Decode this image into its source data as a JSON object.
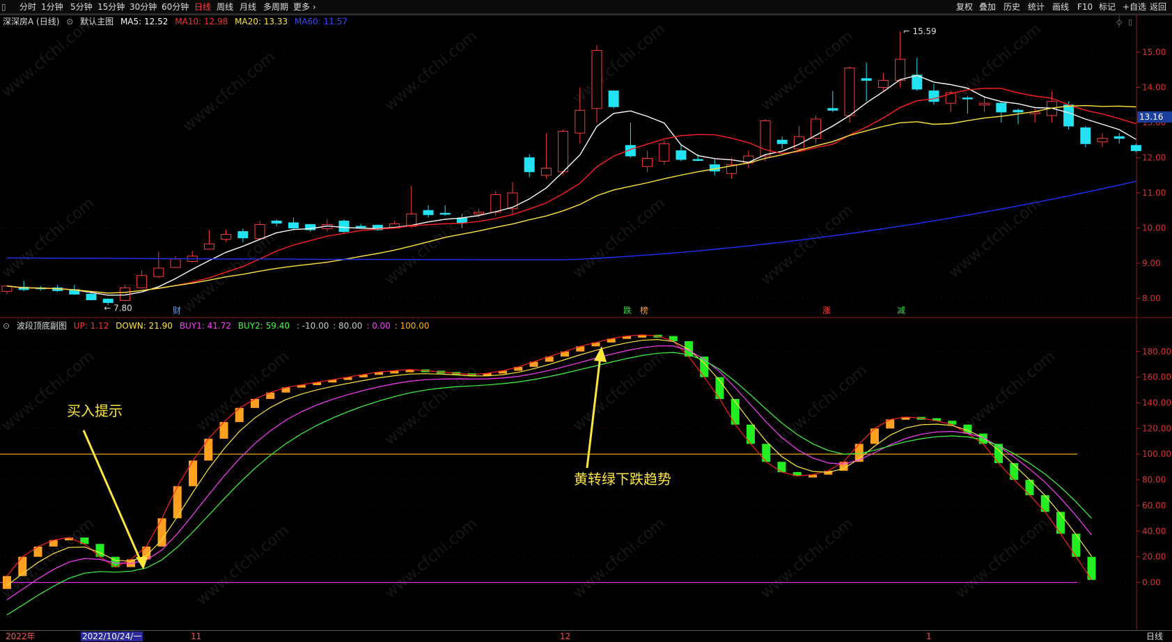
{
  "toolbar": {
    "menu_icon": "grid-menu-icon",
    "periods": [
      "分时",
      "1分钟",
      "5分钟",
      "15分钟",
      "30分钟",
      "60分钟",
      "日线",
      "周线",
      "月线",
      "多周期",
      "更多 ›"
    ],
    "active_period": "日线",
    "right_buttons": [
      "复权",
      "叠加",
      "历史",
      "统计",
      "画线",
      "F10",
      "标记",
      "+自选",
      "返回"
    ]
  },
  "main_panel": {
    "stock": "深深房A (日线)",
    "indicator": "默认主图",
    "ma": [
      {
        "label": "MA5: 12.52",
        "color": "#ffffff"
      },
      {
        "label": "MA10: 12.98",
        "color": "#ff2a2a"
      },
      {
        "label": "MA20: 13.33",
        "color": "#ffe63c"
      },
      {
        "label": "MA60: 11.57",
        "color": "#2e3cff"
      }
    ],
    "y_ticks": [
      "15.00",
      "14.00",
      "13.00",
      "12.00",
      "11.00",
      "10.00",
      "9.00",
      "8.00"
    ],
    "current_price": "13.16",
    "high_label": "15.59",
    "low_label": "7.80",
    "event_marks": [
      {
        "text": "财",
        "color": "#5aa0ff"
      },
      {
        "text": "跌",
        "color": "#2edb4c"
      },
      {
        "text": "榜",
        "color": "#ff9830"
      },
      {
        "text": "涨",
        "color": "#ff4040"
      },
      {
        "text": "减",
        "color": "#2edb4c"
      }
    ]
  },
  "sub_panel": {
    "name": "波段顶底副图",
    "values": [
      {
        "label": "UP: 1.12",
        "color": "#ff3535"
      },
      {
        "label": "DOWN: 21.90",
        "color": "#ffe63c"
      },
      {
        "label": "BUY1: 41.72",
        "color": "#ff3cff"
      },
      {
        "label": "BUY2: 59.40",
        "color": "#3cff3c"
      },
      {
        "label": ": -10.00",
        "color": "#cccccc"
      },
      {
        "label": ": 80.00",
        "color": "#cccccc"
      },
      {
        "label": ": 0.00",
        "color": "#ff3cff"
      },
      {
        "label": ": 100.00",
        "color": "#ffb400"
      }
    ],
    "y_ticks": [
      "180.00",
      "160.00",
      "140.00",
      "120.00",
      "100.00",
      "80.00",
      "60.00",
      "40.00",
      "20.00",
      "0.00"
    ],
    "annotations": [
      "买入提示",
      "黄转绿下跌趋势"
    ]
  },
  "x_axis": {
    "labels": [
      "2022年",
      "2022/10/24/一",
      "11",
      "12",
      "1"
    ],
    "period": "日线"
  },
  "colors": {
    "up_candle": "#ff3b3b",
    "down_candle": "#21e1f2",
    "ma5": "#ffffff",
    "ma10": "#ff2020",
    "ma20": "#ffe63c",
    "ma60": "#2030ff",
    "bar_up": "#ffa020",
    "bar_down": "#22ee22"
  },
  "watermark": "www.cfchi.com"
}
